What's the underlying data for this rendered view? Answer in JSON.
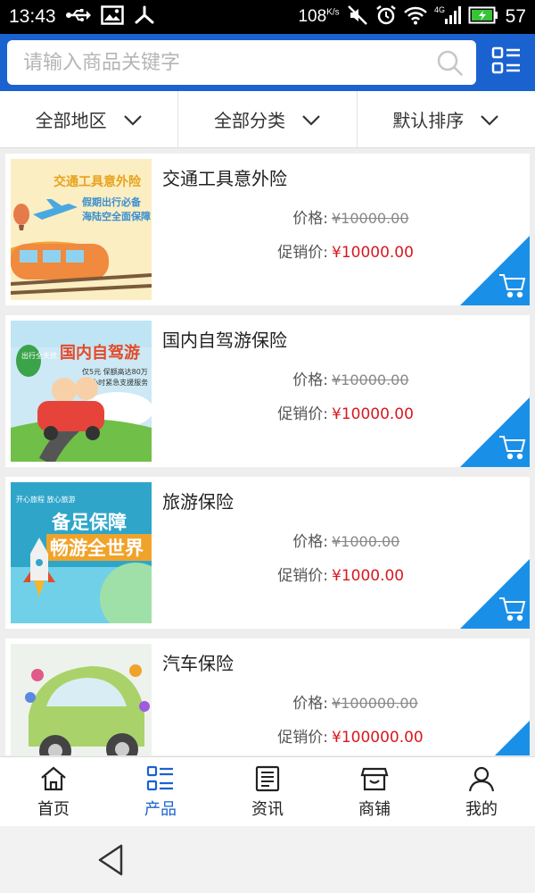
{
  "status_bar": {
    "time": "13:43",
    "speed": "108",
    "speed_unit": "K/s",
    "network": "4G",
    "battery": "57"
  },
  "search": {
    "placeholder": "请输入商品关键字"
  },
  "filters": [
    {
      "label": "全部地区"
    },
    {
      "label": "全部分类"
    },
    {
      "label": "默认排序"
    }
  ],
  "products": [
    {
      "title": "交通工具意外险",
      "price_label": "价格:",
      "price": "¥10000.00",
      "promo_label": "促销价:",
      "promo_price": "¥10000.00",
      "image_text": [
        "交通工具意外险",
        "假期出行必备",
        "海陆空全面保障"
      ]
    },
    {
      "title": "国内自驾游保险",
      "price_label": "价格:",
      "price": "¥10000.00",
      "promo_label": "促销价:",
      "promo_price": "¥10000.00",
      "image_text": [
        "国内自驾游",
        "仅5元 保额高达80万",
        "24小时紧急支援服务",
        "出行全天优"
      ]
    },
    {
      "title": "旅游保险",
      "price_label": "价格:",
      "price": "¥1000.00",
      "promo_label": "促销价:",
      "promo_price": "¥1000.00",
      "image_text": [
        "备足保障",
        "畅游全世界",
        "开心旅程 放心旅游"
      ]
    },
    {
      "title": "汽车保险",
      "price_label": "价格:",
      "price": "¥100000.00",
      "promo_label": "促销价:",
      "promo_price": "¥100000.00",
      "image_text": []
    }
  ],
  "tabs": [
    {
      "label": "首页",
      "icon": "home-icon"
    },
    {
      "label": "产品",
      "icon": "list-icon",
      "active": true
    },
    {
      "label": "资讯",
      "icon": "news-icon"
    },
    {
      "label": "商铺",
      "icon": "shop-icon"
    },
    {
      "label": "我的",
      "icon": "user-icon"
    }
  ],
  "colors": {
    "brand_blue": "#1a62d0",
    "cart_blue": "#1a8fe8",
    "promo_red": "#d71920"
  }
}
